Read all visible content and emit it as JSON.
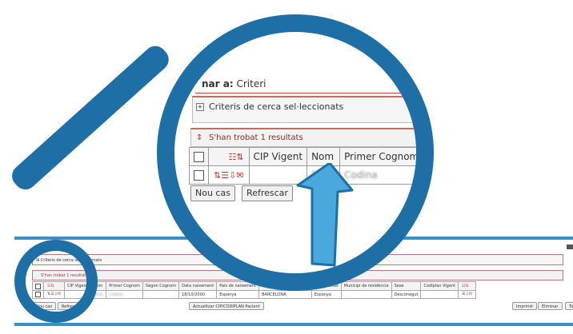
{
  "strip": {
    "tornar_prefix": "Tornar a:",
    "tornar_value": "Criteri",
    "criteria_label": "Criteris de cerca sel·leccionats",
    "results_label": "S'han trobat 1 resultats",
    "headers": [
      "CIP Vigent",
      "Nom",
      "Primer Cognom",
      "Segon Cognom",
      "Data naixement",
      "País de naixement",
      "Província de naixement",
      "Nacionalitat",
      "Municipi de residència",
      "Sexe",
      "Codiplan Vigent"
    ],
    "row": [
      "",
      "Enric",
      "Codina",
      "",
      "18/10/2000",
      "Espanya",
      "BARCELONA",
      "Espanya",
      "",
      "Desconegut",
      ""
    ],
    "buttons": {
      "nou_cas": "Nou cas",
      "refrescar": "Refrescar",
      "actualitzar": "Actualitzar CIP/CODIPLAN Pacient",
      "imprimir": "Imprimir",
      "eliminar": "Eliminar",
      "tornar": "Tornar"
    }
  },
  "lens": {
    "tornar_prefix": "nar a:",
    "tornar_value": "Criteri",
    "criteria_label": "Criteris de cerca sel·leccionats",
    "results_label": "S'han trobat 1 resultats",
    "headers": [
      "CIP Vigent",
      "Nom",
      "Primer Cognom"
    ],
    "row": [
      "",
      "Enric",
      "Codina"
    ],
    "buttons": {
      "nou_cas": "Nou cas",
      "refrescar": "Refrescar"
    }
  },
  "colors": {
    "accent": "#1e6fa5",
    "arrow": "#4aa8dc",
    "rule": "#c44444"
  },
  "icons": [
    "magnifier-glass-icon",
    "expand-plus-icon",
    "results-sort-icon",
    "column-config-icon",
    "row-action-icons",
    "up-arrow-icon"
  ]
}
